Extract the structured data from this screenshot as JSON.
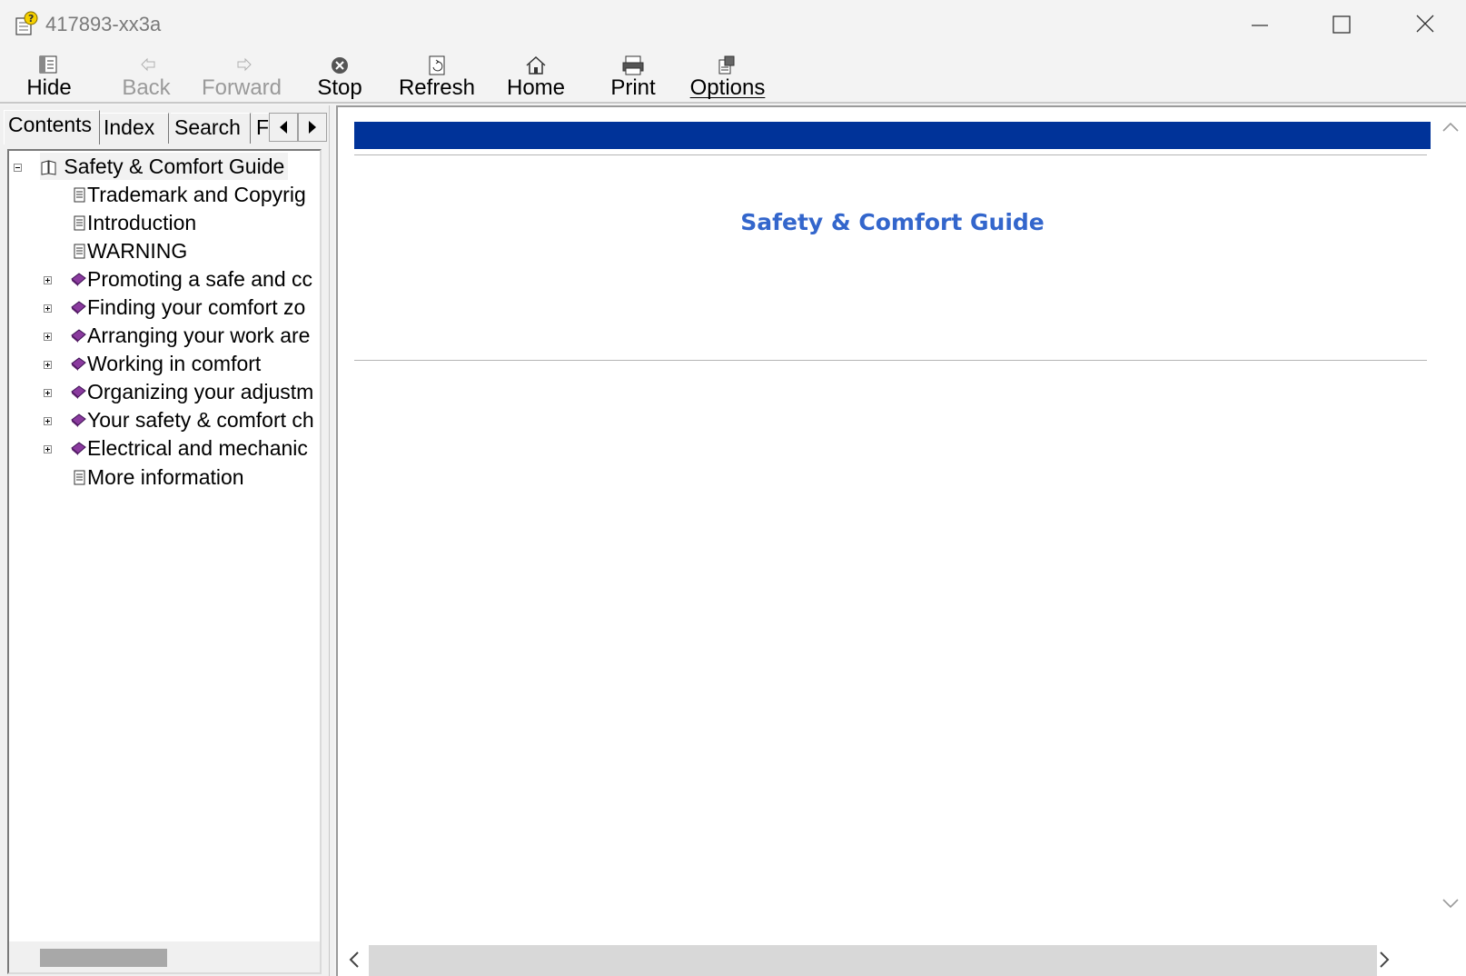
{
  "window": {
    "title": "417893-xx3a"
  },
  "toolbar": {
    "hide": "Hide",
    "back": "Back",
    "forward": "Forward",
    "stop": "Stop",
    "refresh": "Refresh",
    "home": "Home",
    "print": "Print",
    "options": "Options"
  },
  "tabs": {
    "contents": "Contents",
    "index": "Index",
    "search": "Search",
    "favorites": "F"
  },
  "tree": {
    "root": "Safety & Comfort Guide",
    "items": [
      "Trademark and Copyrig",
      "Introduction",
      "WARNING",
      "Promoting a safe and cc",
      "Finding your comfort zo",
      "Arranging your work are",
      "Working in comfort",
      "Organizing your adjustm",
      "Your safety & comfort ch",
      "Electrical and mechanic",
      "More information"
    ]
  },
  "content": {
    "title": "Safety & Comfort Guide",
    "accent_bar_color": "#003399",
    "title_color": "#3366cc"
  }
}
